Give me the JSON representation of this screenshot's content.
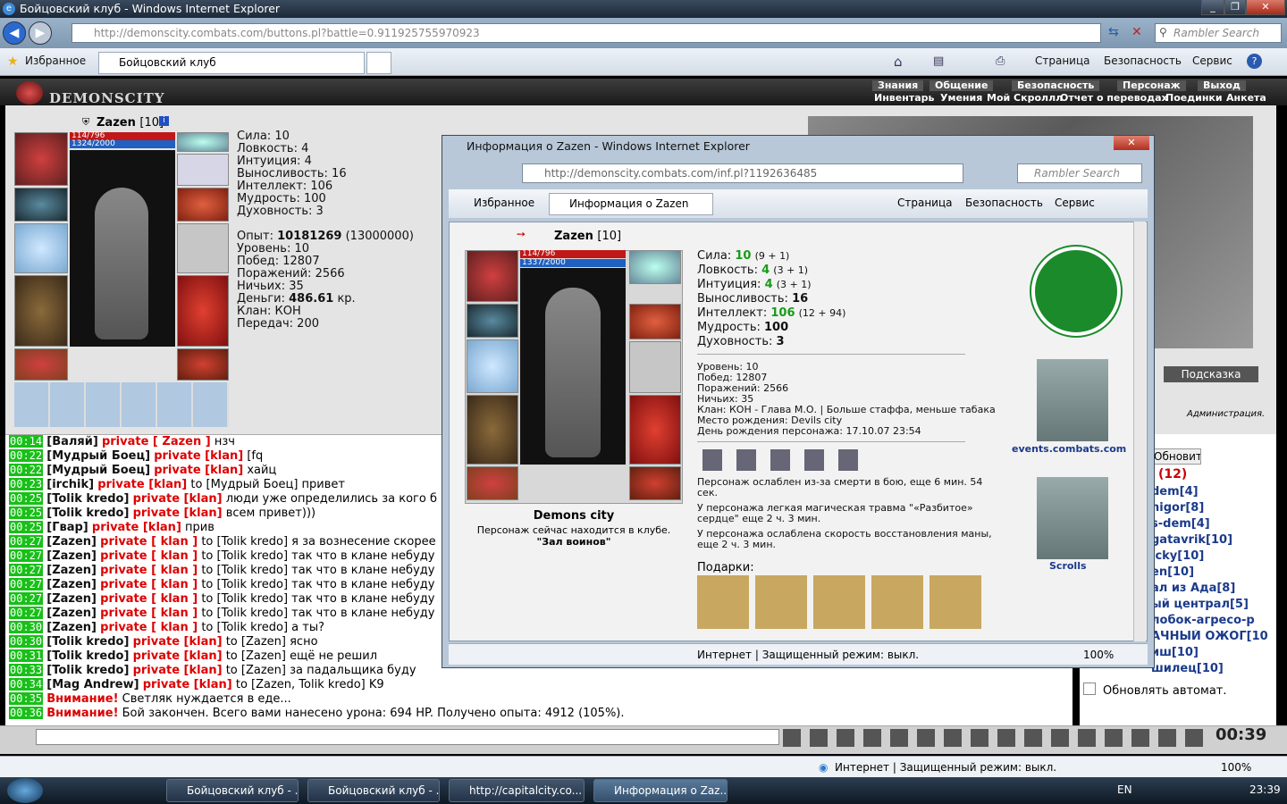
{
  "window": {
    "title": "Бойцовский клуб - Windows Internet Explorer",
    "address": "http://demonscity.combats.com/buttons.pl?battle=0.911925755970923",
    "search_placeholder": "Rambler Search"
  },
  "favbar": {
    "favorites": "Избранное",
    "tab": "Бойцовский клуб",
    "page": "Страница",
    "safety": "Безопасность",
    "service": "Сервис"
  },
  "game": {
    "logo": "DEMONSCITY",
    "menu_top": [
      "Знания",
      "Общение",
      "Безопасность",
      "Персонаж",
      "Выход"
    ],
    "menu_bottom": [
      "Инвентарь",
      "Умения",
      "Мой Скроллл",
      "Отчет о переводах",
      "Поединки",
      "Анкета"
    ],
    "char_name": "Zazen",
    "char_level": "[10]",
    "hp": "114/796",
    "mana": "1324/2000",
    "stats": [
      "Сила: 10",
      "Ловкость: 4",
      "Интуиция: 4",
      "Выносливость: 16",
      "Интеллект: 106",
      "Мудрость: 100",
      "Духовность: 3"
    ],
    "exp_label": "Опыт:",
    "exp_value": "10181269",
    "exp_next": "(13000000)",
    "info": [
      "Уровень: 10",
      "Побед: 12807",
      "Поражений: 2566",
      "Ничьих: 35"
    ],
    "money_label": "Деньги:",
    "money_value": "486.61",
    "money_unit": "кр.",
    "clan": "Клан: КОН",
    "transfers": "Передач: 200"
  },
  "chat": [
    {
      "time": "00:14",
      "name": "[Валяй]",
      "priv": "private [ Zazen ]",
      "text": "нзч"
    },
    {
      "time": "00:22",
      "name": "[Мудрый Боец]",
      "priv": "private [klan]",
      "text": "[fq"
    },
    {
      "time": "00:22",
      "name": "[Мудрый Боец]",
      "priv": "private [klan]",
      "text": "хайц"
    },
    {
      "time": "00:23",
      "name": "[irchik]",
      "priv": "private [klan]",
      "text": "to [Мудрый Боец] привет"
    },
    {
      "time": "00:25",
      "name": "[Tolik kredo]",
      "priv": "private [klan]",
      "text": "люди уже определились за кого б"
    },
    {
      "time": "00:25",
      "name": "[Tolik kredo]",
      "priv": "private [klan]",
      "text": "всем привет)))"
    },
    {
      "time": "00:25",
      "name": "[Гвар]",
      "priv": "private [klan]",
      "text": "прив"
    },
    {
      "time": "00:27",
      "name": "[Zazen]",
      "priv": "private [ klan ]",
      "text": "to [Tolik kredo] я за вознесение скорее"
    },
    {
      "time": "00:27",
      "name": "[Zazen]",
      "priv": "private [ klan ]",
      "text": "to [Tolik kredo] так что в клане небуду"
    },
    {
      "time": "00:27",
      "name": "[Zazen]",
      "priv": "private [ klan ]",
      "text": "to [Tolik kredo] так что в клане небуду"
    },
    {
      "time": "00:27",
      "name": "[Zazen]",
      "priv": "private [ klan ]",
      "text": "to [Tolik kredo] так что в клане небуду"
    },
    {
      "time": "00:27",
      "name": "[Zazen]",
      "priv": "private [ klan ]",
      "text": "to [Tolik kredo] так что в клане небуду"
    },
    {
      "time": "00:27",
      "name": "[Zazen]",
      "priv": "private [ klan ]",
      "text": "to [Tolik kredo] так что в клане небуду"
    },
    {
      "time": "00:30",
      "name": "[Zazen]",
      "priv": "private [ klan ]",
      "text": "to [Tolik kredo] а ты?"
    },
    {
      "time": "00:30",
      "name": "[Tolik kredo]",
      "priv": "private [klan]",
      "text": "to [Zazen] ясно"
    },
    {
      "time": "00:31",
      "name": "[Tolik kredo]",
      "priv": "private [klan]",
      "text": "to [Zazen] ещё не решил"
    },
    {
      "time": "00:33",
      "name": "[Tolik kredo]",
      "priv": "private [klan]",
      "text": "to [Zazen] за падальщика буду"
    },
    {
      "time": "00:34",
      "name": "[Mag Andrew]",
      "priv": "private [klan]",
      "text": "to [Zazen, Tolik kredo] K9"
    },
    {
      "time": "00:35",
      "name": "",
      "priv": "Внимание!",
      "text": "Светляк нуждается в еде..."
    },
    {
      "time": "00:36",
      "name": "",
      "priv": "Внимание!",
      "text": "Бой закончен. Всего вами нанесено урона: 694 HP. Получено опыта: 4912 (105%)."
    }
  ],
  "right": {
    "refresh": "Обновить",
    "count": "(12)",
    "users": [
      "dem[4]",
      "nigor[8]",
      "s-dem[4]",
      "gatavrik[10]",
      "icky[10]",
      "en[10]",
      "ал из Ада[8]",
      "ый централ[5]",
      "лобок-агресо-р",
      "АЧНЫЙ ОЖОГ[10",
      "иш[10]",
      "шилец[10]"
    ],
    "auto": "Обновлять автомат.",
    "hint": "Подсказка",
    "admin": "Администрация."
  },
  "popup": {
    "title": "Информация о Zazen - Windows Internet Explorer",
    "address": "http://demonscity.combats.com/inf.pl?1192636485",
    "tab": "Информация о Zazen",
    "name": "Zazen",
    "level": "[10]",
    "hp": "114/796",
    "mana": "1337/2000",
    "stats": [
      {
        "l": "Сила:",
        "v": "10",
        "x": "(9 + 1)"
      },
      {
        "l": "Ловкость:",
        "v": "4",
        "x": "(3 + 1)"
      },
      {
        "l": "Интуиция:",
        "v": "4",
        "x": "(3 + 1)"
      },
      {
        "l": "Выносливость:",
        "v": "16",
        "x": ""
      },
      {
        "l": "Интеллект:",
        "v": "106",
        "x": "(12 + 94)"
      },
      {
        "l": "Мудрость:",
        "v": "100",
        "x": ""
      },
      {
        "l": "Духовность:",
        "v": "3",
        "x": ""
      }
    ],
    "info": [
      "Уровень: 10",
      "Побед: 12807",
      "Поражений: 2566",
      "Ничьих: 35"
    ],
    "clan": "Клан: КОН - Глава М.О. | Больше стаффа, меньше табака",
    "birthplace": "Место рождения: Devils city",
    "birthday": "День рождения персонажа: 17.10.07 23:54",
    "effects": [
      "Персонаж ослаблен из-за смерти в бою, еще 6 мин. 54 сек.",
      "У персонажа легкая магическая травма \"«Разбитое» сердце\" еще 2 ч. 3 мин.",
      "У персонажа ослаблена скорость восстановления маны, еще 2 ч. 3 мин."
    ],
    "gifts": "Подарки:",
    "city": "Demons city",
    "location": "Персонаж сейчас находится в клубе.",
    "hall": "\"Зал воинов\"",
    "events": "events.combats.com",
    "scrolls": "Scrolls",
    "status": "Интернет | Защищенный режим: выкл.",
    "zoom": "100%"
  },
  "statusbar": {
    "text": "Интернет | Защищенный режим: выкл.",
    "zoom": "100%"
  },
  "taskbar": {
    "items": [
      "Бойцовский клуб - ...",
      "Бойцовский клуб - ...",
      "http://capitalcity.co...",
      "Информация о Zaz..."
    ],
    "lang": "EN",
    "time": "23:39"
  },
  "clock": "00:39"
}
